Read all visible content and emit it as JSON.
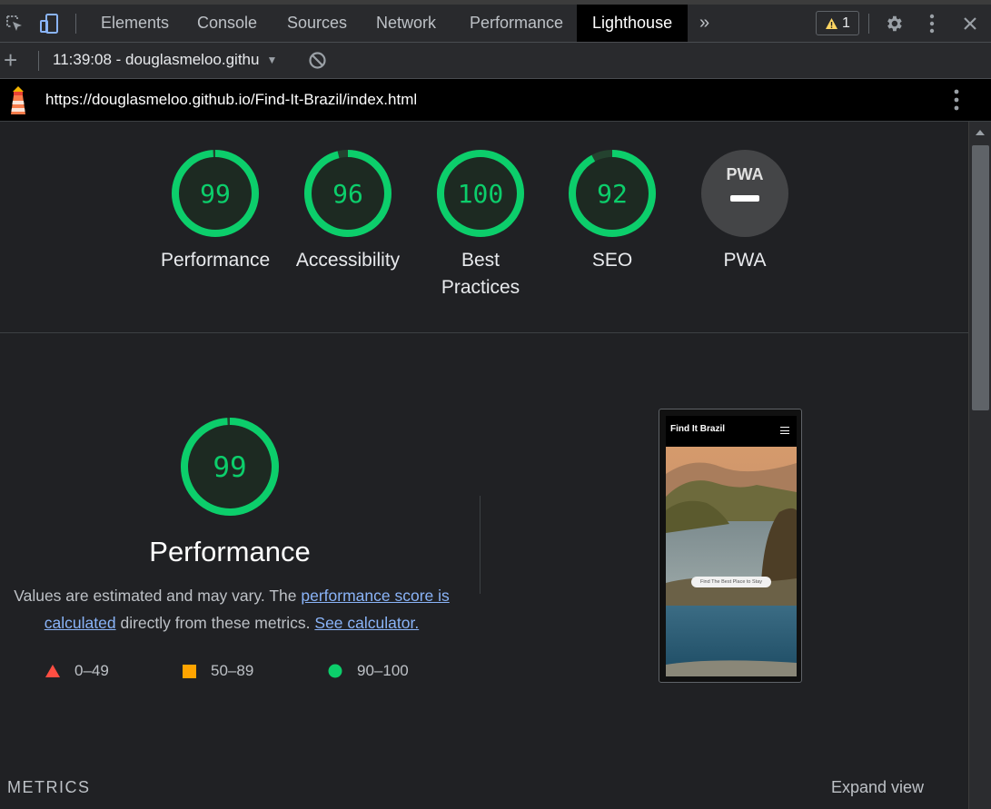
{
  "tabbar": {
    "tabs": [
      "Elements",
      "Console",
      "Sources",
      "Network",
      "Performance",
      "Lighthouse"
    ],
    "active_tab": "Lighthouse",
    "more_tabs_glyph": "»",
    "warning_count": "1",
    "icons": [
      "inspect-element-icon",
      "device-toolbar-icon",
      "more-tabs-icon",
      "warning-icon",
      "gear-icon",
      "kebab-menu-icon",
      "close-icon"
    ]
  },
  "reportbar": {
    "new_report_glyph": "+",
    "selected_report": "11:39:08 - douglasmeloo.githu",
    "dropdown_glyph": "▼"
  },
  "urlbar": {
    "url": "https://douglasmeloo.github.io/Find-It-Brazil/index.html"
  },
  "gauges": [
    {
      "label": "Performance",
      "score": "99",
      "fraction": 0.99
    },
    {
      "label": "Accessibility",
      "score": "96",
      "fraction": 0.96
    },
    {
      "label_line1": "Best",
      "label_line2": "Practices",
      "score": "100",
      "fraction": 1.0
    },
    {
      "label": "SEO",
      "score": "92",
      "fraction": 0.92
    },
    {
      "label": "PWA",
      "badge": "PWA"
    }
  ],
  "performance": {
    "score": "99",
    "fraction": 0.99,
    "title": "Performance",
    "desc_prefix": "Values are estimated and may vary. The ",
    "link1": "performance score is calculated",
    "desc_middle": " directly from these metrics. ",
    "link2": "See calculator.",
    "legend": [
      {
        "range": "0–49",
        "shape": "triangle",
        "color": "#ff4e42"
      },
      {
        "range": "50–89",
        "shape": "square",
        "color": "#ffa400"
      },
      {
        "range": "90–100",
        "shape": "circle",
        "color": "#0cce6b"
      }
    ]
  },
  "screenshot": {
    "brand": "Find It Brazil",
    "button": "Find The Best Place to Stay"
  },
  "metrics": {
    "label": "METRICS",
    "expand": "Expand view"
  },
  "colors": {
    "pass": "#0cce6b",
    "pass_fill": "#1d2a22",
    "background": "#202124",
    "link": "#8ab4f8"
  }
}
